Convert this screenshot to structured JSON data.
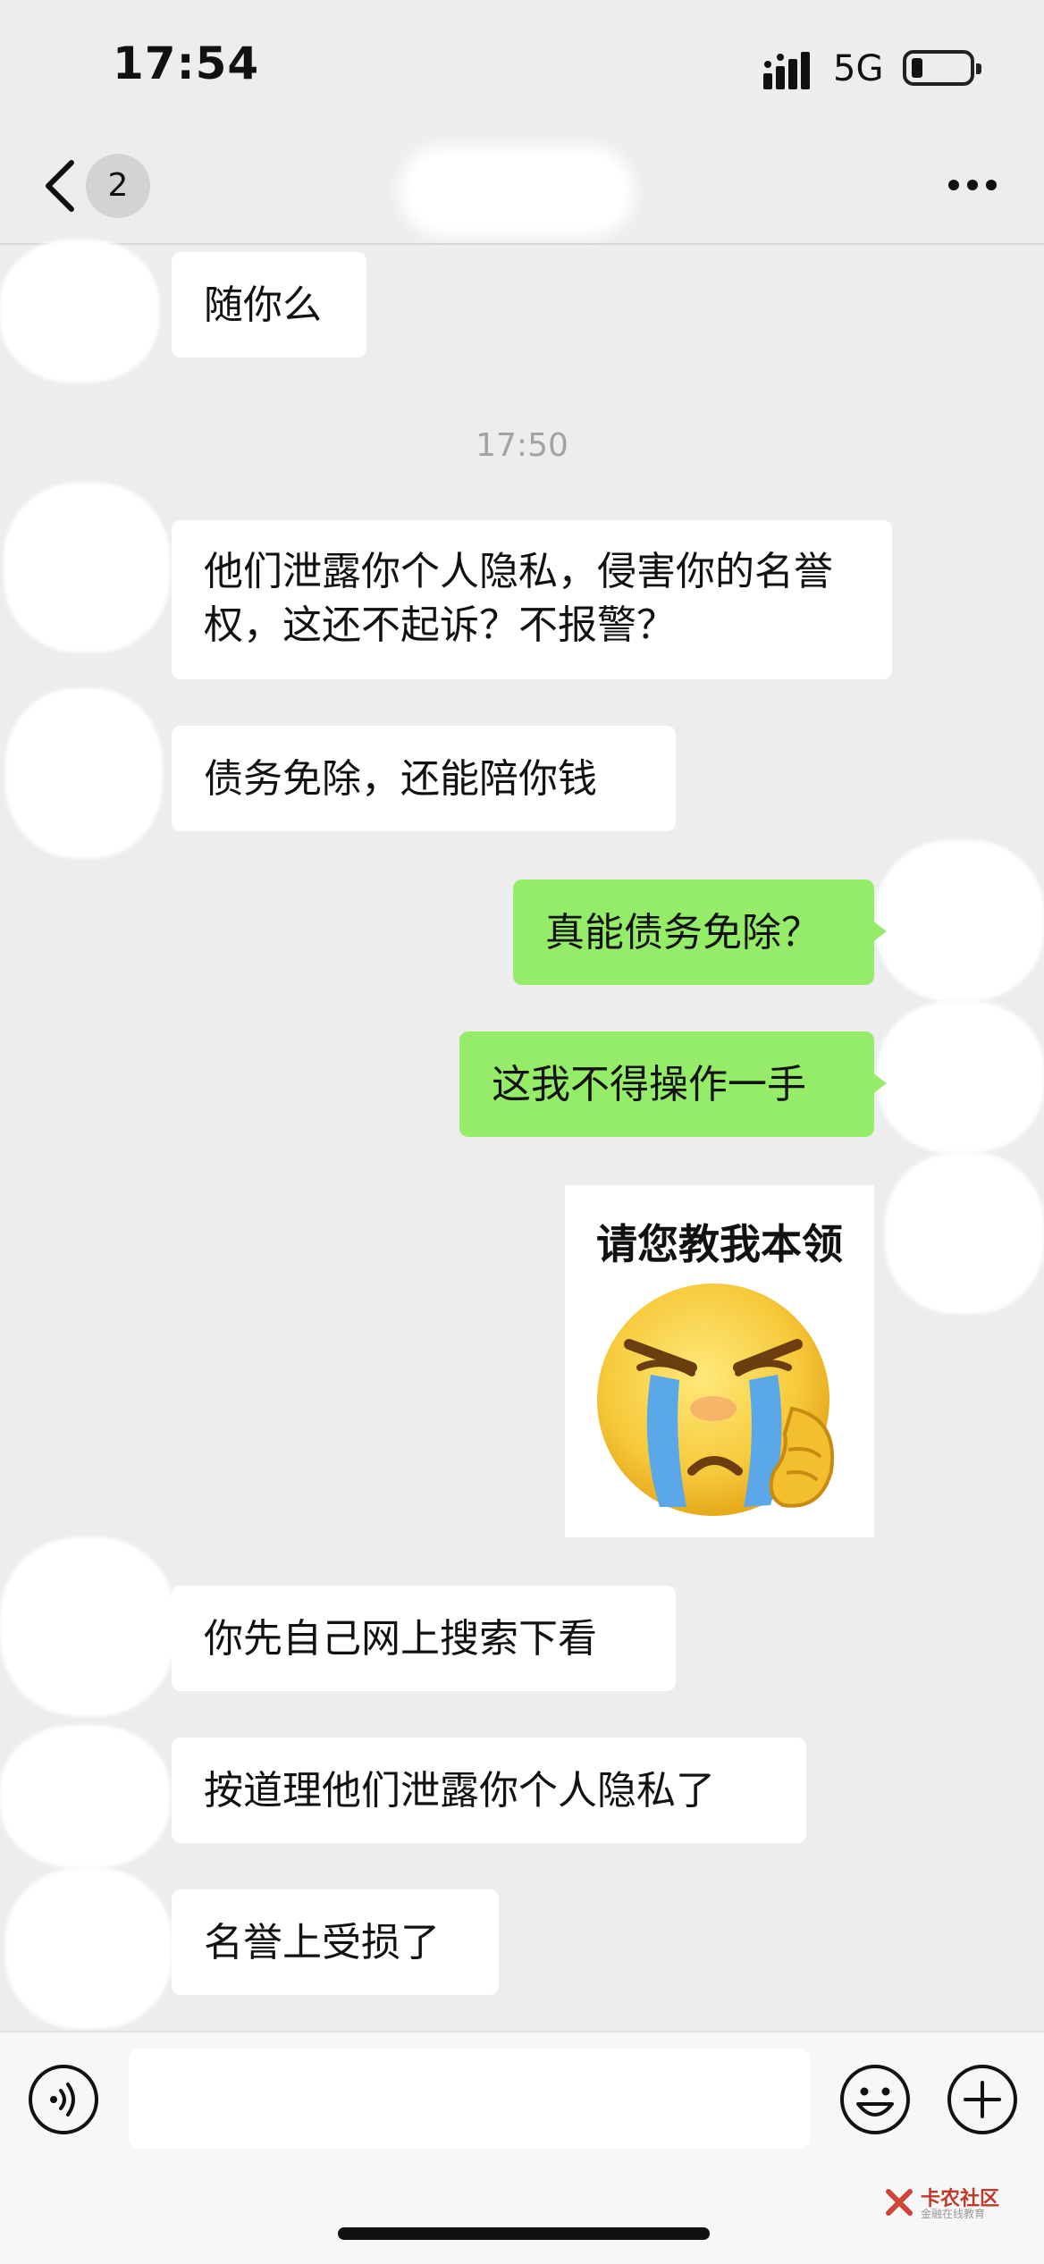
{
  "status_bar": {
    "time": "17:54",
    "network": "5G"
  },
  "nav": {
    "unread_count": "2"
  },
  "messages": [
    {
      "side": "left",
      "text": "随你么"
    },
    {
      "side": "left",
      "text": "他们泄露你个人隐私，侵害你的名誉权，这还不起诉？不报警？"
    },
    {
      "side": "left",
      "text": "债务免除，还能陪你钱"
    },
    {
      "side": "right",
      "text": "真能债务免除？"
    },
    {
      "side": "right",
      "text": "这我不得操作一手"
    },
    {
      "side": "left",
      "text": "你先自己网上搜索下看"
    },
    {
      "side": "left",
      "text": "按道理他们泄露你个人隐私了"
    },
    {
      "side": "left",
      "text": "名誉上受损了"
    }
  ],
  "timestamp": "17:50",
  "sticker": {
    "caption": "请您教我本领",
    "icon": "crying-emoji"
  },
  "input_bar": {
    "value": "",
    "voice_icon": "voice-icon",
    "emoji_icon": "emoji-icon",
    "plus_icon": "plus-icon"
  },
  "watermark": {
    "name": "卡农社区",
    "tagline": "金融在线教育"
  },
  "colors": {
    "background": "#ededed",
    "my_bubble": "#95ec69",
    "other_bubble": "#ffffff"
  }
}
